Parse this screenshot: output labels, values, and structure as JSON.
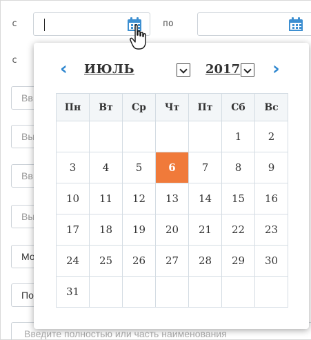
{
  "filter": {
    "from_label": "с",
    "to_label": "по",
    "second_row_label": "с",
    "from_value": "",
    "to_value": ""
  },
  "background_inputs": [
    "Вв",
    "Вы",
    "Вв",
    "Вы",
    "Мо",
    "По"
  ],
  "bottom_hint": "Введите полностью или часть наименования",
  "calendar": {
    "month": "ИЮЛЬ",
    "year": "2017",
    "prev_icon": "chevron-left-icon",
    "next_icon": "chevron-right-icon",
    "weekdays": [
      "Пн",
      "Вт",
      "Ср",
      "Чт",
      "Пт",
      "Сб",
      "Вс"
    ],
    "weeks": [
      [
        "",
        "",
        "",
        "",
        "",
        "1",
        "2"
      ],
      [
        "3",
        "4",
        "5",
        "6",
        "7",
        "8",
        "9"
      ],
      [
        "10",
        "11",
        "12",
        "13",
        "14",
        "15",
        "16"
      ],
      [
        "17",
        "18",
        "19",
        "20",
        "21",
        "22",
        "23"
      ],
      [
        "24",
        "25",
        "26",
        "27",
        "28",
        "29",
        "30"
      ],
      [
        "31",
        "",
        "",
        "",
        "",
        "",
        ""
      ]
    ],
    "selected_day": "6",
    "colors": {
      "accent": "#2d86cf",
      "today": "#f07a3a",
      "header_bg": "#f3f6f8"
    }
  }
}
